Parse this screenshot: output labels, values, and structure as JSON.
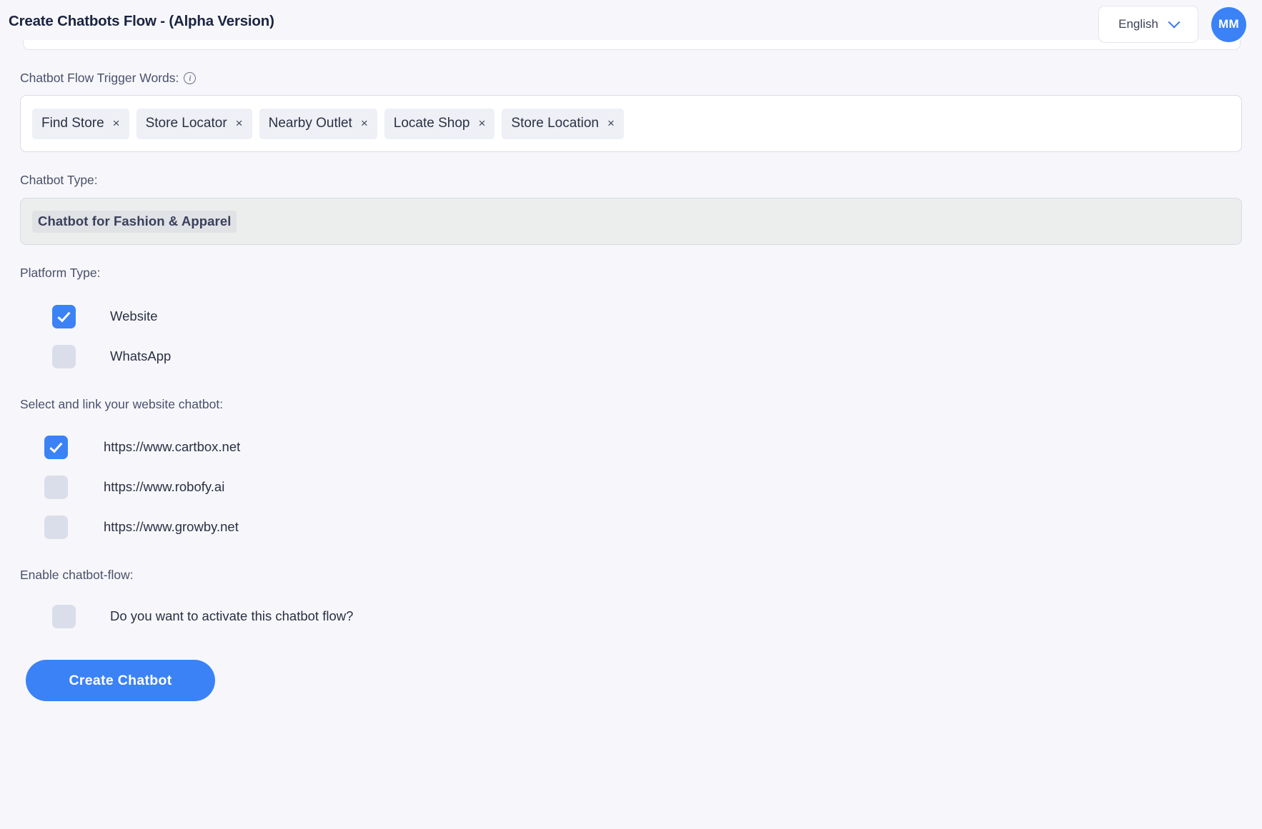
{
  "header": {
    "title": "Create Chatbots Flow - (Alpha Version)",
    "language": "English",
    "avatar_initials": "MM",
    "chevron_icon": "chevron-down-icon"
  },
  "trigger_words": {
    "label": "Chatbot Flow Trigger Words:",
    "info_icon": "info-icon",
    "info_glyph": "i",
    "tags": [
      {
        "text": "Find Store",
        "remove": "×"
      },
      {
        "text": "Store Locator",
        "remove": "×"
      },
      {
        "text": "Nearby Outlet",
        "remove": "×"
      },
      {
        "text": "Locate Shop",
        "remove": "×"
      },
      {
        "text": "Store Location",
        "remove": "×"
      }
    ]
  },
  "chatbot_type": {
    "label": "Chatbot Type:",
    "value": "Chatbot for Fashion & Apparel"
  },
  "platform_type": {
    "label": "Platform Type:",
    "options": [
      {
        "label": "Website",
        "checked": true
      },
      {
        "label": "WhatsApp",
        "checked": false
      }
    ]
  },
  "website_chatbot": {
    "label": "Select and link your website chatbot:",
    "options": [
      {
        "label": "https://www.cartbox.net",
        "checked": true
      },
      {
        "label": "https://www.robofy.ai",
        "checked": false
      },
      {
        "label": "https://www.growby.net",
        "checked": false
      }
    ]
  },
  "enable_flow": {
    "label": "Enable chatbot-flow:",
    "options": [
      {
        "label": "Do you want to activate this chatbot flow?",
        "checked": false
      }
    ]
  },
  "submit": {
    "label": "Create Chatbot"
  },
  "colors": {
    "accent": "#3b82f6",
    "page_bg": "#f7f7fb",
    "text": "#2a2f42",
    "label": "#49506a",
    "tag_bg": "#eef0f6",
    "checkbox_off": "#dadeea"
  }
}
